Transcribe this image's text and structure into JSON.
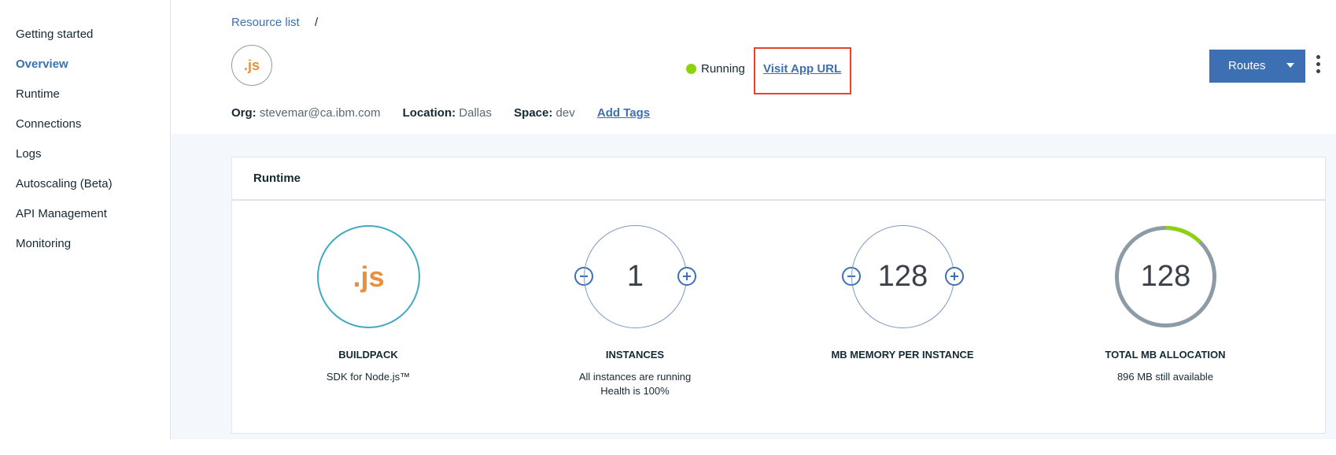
{
  "sidebar": {
    "items": [
      {
        "label": "Getting started",
        "active": false
      },
      {
        "label": "Overview",
        "active": true
      },
      {
        "label": "Runtime",
        "active": false
      },
      {
        "label": "Connections",
        "active": false
      },
      {
        "label": "Logs",
        "active": false
      },
      {
        "label": "Autoscaling (Beta)",
        "active": false
      },
      {
        "label": "API Management",
        "active": false
      },
      {
        "label": "Monitoring",
        "active": false
      }
    ]
  },
  "header": {
    "breadcrumb": {
      "link": "Resource list",
      "separator": "/"
    },
    "app_logo_text": ".js",
    "status": {
      "label": "Running",
      "color": "#8cd211"
    },
    "visit_app_url": "Visit App URL",
    "routes_button": "Routes",
    "meta": {
      "org": {
        "label": "Org:",
        "value": "stevemar@ca.ibm.com"
      },
      "location": {
        "label": "Location:",
        "value": "Dallas"
      },
      "space": {
        "label": "Space:",
        "value": "dev"
      },
      "add_tags": "Add Tags"
    }
  },
  "runtime": {
    "title": "Runtime",
    "buildpack": {
      "logo": ".js",
      "label": "BUILDPACK",
      "desc": [
        "SDK for Node.js™"
      ]
    },
    "instances": {
      "value": "1",
      "label": "INSTANCES",
      "desc": [
        "All instances are running",
        "Health is 100%"
      ]
    },
    "memory": {
      "value": "128",
      "label": "MB MEMORY PER INSTANCE",
      "desc": []
    },
    "total": {
      "value": "128",
      "label": "TOTAL MB ALLOCATION",
      "desc": [
        "896 MB still available"
      ],
      "used_fraction": 0.125
    }
  },
  "colors": {
    "accent": "#3d70b2",
    "highlight_box": "#e8442c",
    "js_orange": "#e8913a",
    "buildpack_ring": "#41aac3",
    "allocation_used": "#8cd211",
    "allocation_free": "#8c9ba5"
  },
  "icons": [
    "minus-icon",
    "plus-icon",
    "overflow-menu-icon",
    "caret-down-icon",
    "status-dot-icon"
  ]
}
